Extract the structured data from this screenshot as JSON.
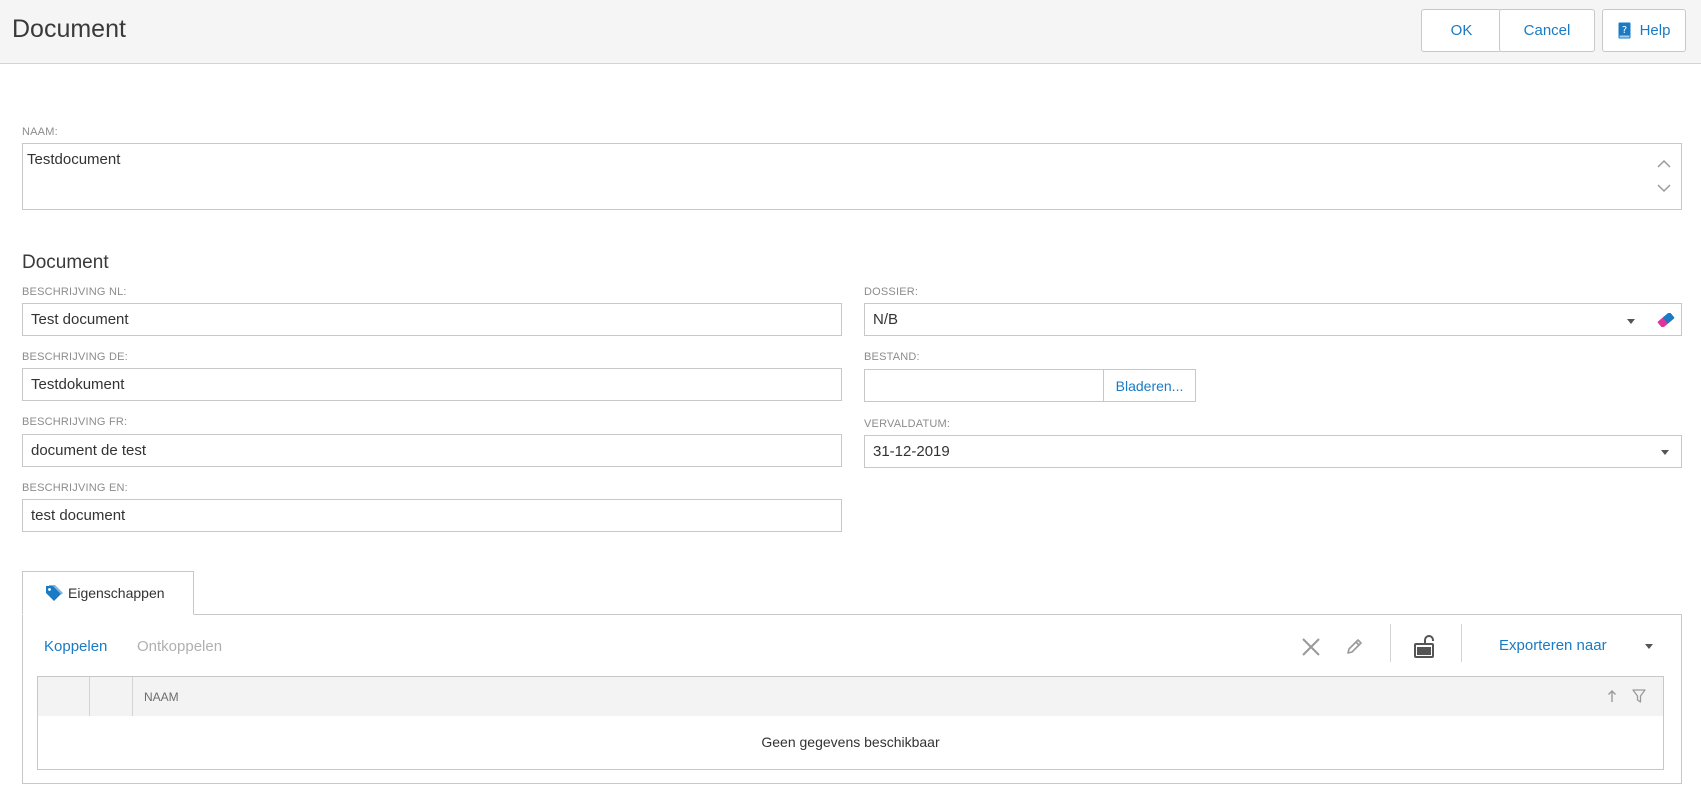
{
  "header": {
    "title": "Document",
    "ok_label": "OK",
    "cancel_label": "Cancel",
    "help_label": "Help"
  },
  "naam": {
    "label": "NAAM:",
    "value": "Testdocument"
  },
  "section": {
    "title": "Document"
  },
  "fields": {
    "beschrijving_nl": {
      "label": "BESCHRIJVING NL:",
      "value": "Test document"
    },
    "beschrijving_de": {
      "label": "BESCHRIJVING DE:",
      "value": "Testdokument"
    },
    "beschrijving_fr": {
      "label": "BESCHRIJVING FR:",
      "value": "document de test"
    },
    "beschrijving_en": {
      "label": "BESCHRIJVING EN:",
      "value": "test document"
    },
    "dossier": {
      "label": "DOSSIER:",
      "value": "N/B"
    },
    "bestand": {
      "label": "BESTAND:",
      "value": "",
      "browse_label": "Bladeren..."
    },
    "vervaldatum": {
      "label": "VERVALDATUM:",
      "value": "31-12-2019"
    }
  },
  "tabs": [
    {
      "label": "Eigenschappen",
      "icon": "tag-icon",
      "active": true
    }
  ],
  "toolbar": {
    "koppelen_label": "Koppelen",
    "ontkoppelen_label": "Ontkoppelen",
    "export_label": "Exporteren naar"
  },
  "grid": {
    "columns": [
      {
        "label": "NAAM"
      }
    ],
    "empty_message": "Geen gegevens beschikbaar"
  },
  "colors": {
    "accent": "#1a7bc4",
    "disabled": "#b0b0b0",
    "header_bg": "#f5f5f5",
    "border": "#c8c8c8"
  }
}
